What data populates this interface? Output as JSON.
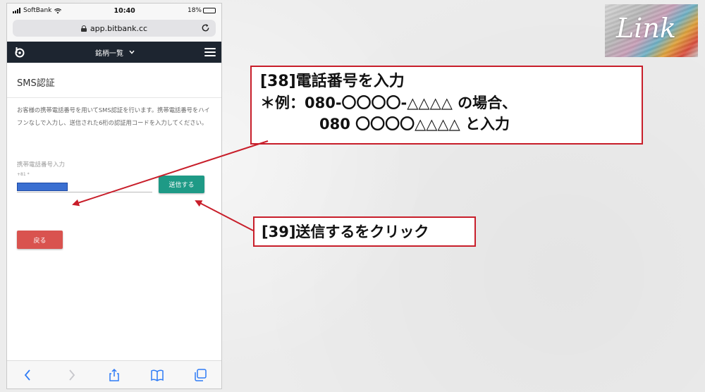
{
  "status_bar": {
    "carrier": "SoftBank",
    "time": "10:40",
    "battery": "18%",
    "battery_level": 0.18
  },
  "browser": {
    "url": "app.bitbank.cc"
  },
  "app_header": {
    "nav_title": "銘柄一覧"
  },
  "page": {
    "title": "SMS認証",
    "description": "お客様の携帯電話番号を用いてSMS認証を行います。携帯電話番号をハイフンなしで入力し、送信された6桁の認証用コードを入力してください。",
    "field_label": "携帯電話番号入力",
    "country_code": "+81 *",
    "phone_value": "",
    "send_button": "送信する",
    "back_button": "戻る"
  },
  "callouts": {
    "step38_line1": "[38]電話番号を入力",
    "step38_line2": "＊例：080-〇〇〇〇-△△△△ の場合、",
    "step38_line3": "080 〇〇〇〇△△△△ と入力",
    "step39": "[39]送信するをクリック"
  },
  "brand": {
    "name": "Link"
  },
  "colors": {
    "header_bg": "#1d2530",
    "send_button": "#1e9a86",
    "back_button": "#d9534f",
    "callout_border": "#c81e2a",
    "arrow": "#c81e2a",
    "phone_fill": "#3a6fd1"
  },
  "icons": {
    "toolbar": [
      "back-icon",
      "forward-icon",
      "share-icon",
      "bookmarks-icon",
      "tabs-icon"
    ]
  }
}
